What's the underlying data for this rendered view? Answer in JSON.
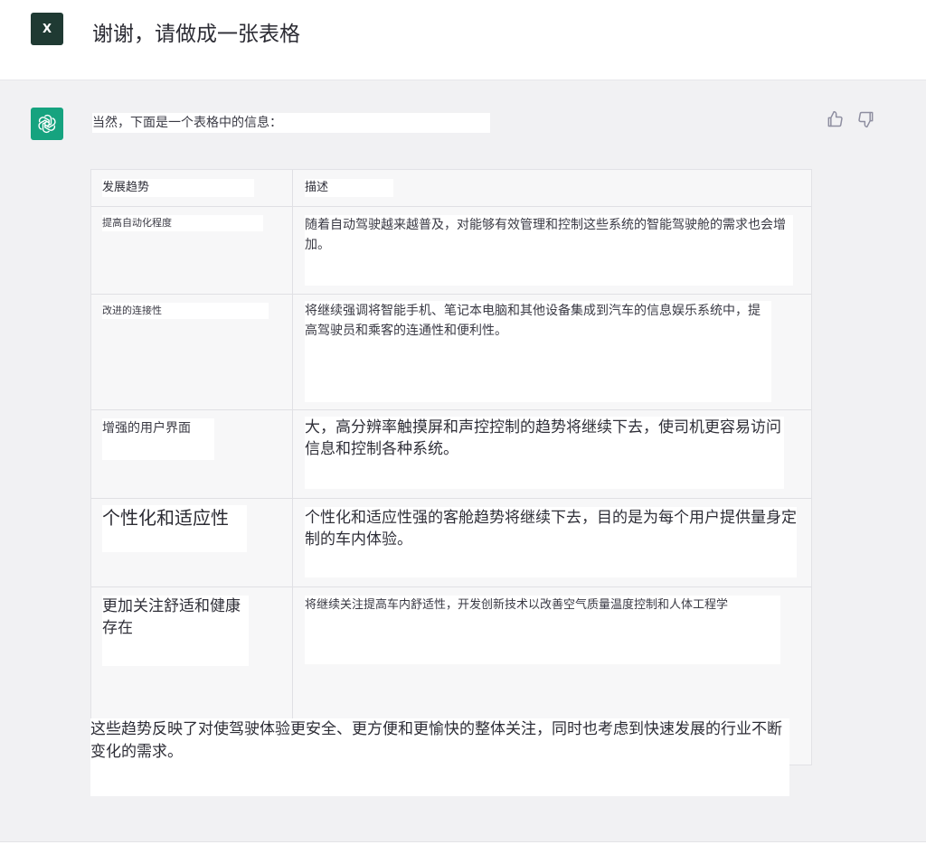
{
  "user_message": {
    "avatar_letter": "X",
    "text": "谢谢，请做成一张表格"
  },
  "assistant_message": {
    "intro": "当然，下面是一个表格中的信息：",
    "table": {
      "headers": [
        "发展趋势",
        "描述"
      ],
      "rows": [
        {
          "trend": "提高自动化程度",
          "description": "随着自动驾驶越来越普及，对能够有效管理和控制这些系统的智能驾驶舱的需求也会增加。"
        },
        {
          "trend": "改进的连接性",
          "description": "将继续强调将智能手机、笔记本电脑和其他设备集成到汽车的信息娱乐系统中，提高驾驶员和乘客的连通性和便利性。"
        },
        {
          "trend": "增强的用户界面",
          "description": "大，高分辨率触摸屏和声控控制的趋势将继续下去，使司机更容易访问信息和控制各种系统。"
        },
        {
          "trend": "个性化和适应性",
          "description": "个性化和适应性强的客舱趋势将继续下去，目的是为每个用户提供量身定制的车内体验。"
        },
        {
          "trend": "更加关注舒适和健康存在",
          "description": "将继续关注提高车内舒适性，开发创新技术以改善空气质量温度控制和人体工程学"
        }
      ]
    },
    "summary": "这些趋势反映了对使驾驶体验更安全、更方便和更愉快的整体关注，同时也考虑到快速发展的行业不断变化的需求。"
  },
  "icons": {
    "openai": "openai-logo-icon",
    "thumbs_up": "thumbs-up-icon",
    "thumbs_down": "thumbs-down-icon"
  },
  "colors": {
    "user_avatar_bg": "#1f3a33",
    "gpt_avatar_bg": "#16a37f",
    "assistant_bg": "#f1f1f3"
  }
}
